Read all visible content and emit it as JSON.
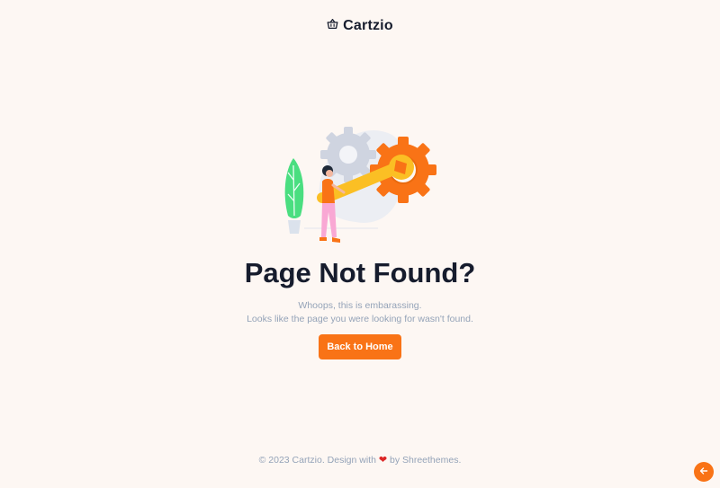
{
  "brand": {
    "name": "Cartzio",
    "icon": "basket-icon"
  },
  "error": {
    "title": "Page Not Found?",
    "line1": "Whoops, this is embarassing.",
    "line2": "Looks like the page you were looking for wasn't found.",
    "button": "Back to Home"
  },
  "footer": {
    "prefix": "© 2023 Cartzio. Design with",
    "suffix": "by Shreethemes.",
    "heart_icon": "heart-icon"
  },
  "back_to_top": {
    "icon": "arrow-left-icon"
  },
  "colors": {
    "accent": "#f97316",
    "heading": "#161c2d",
    "muted": "#94a3b8",
    "background": "#fdf7f3"
  }
}
